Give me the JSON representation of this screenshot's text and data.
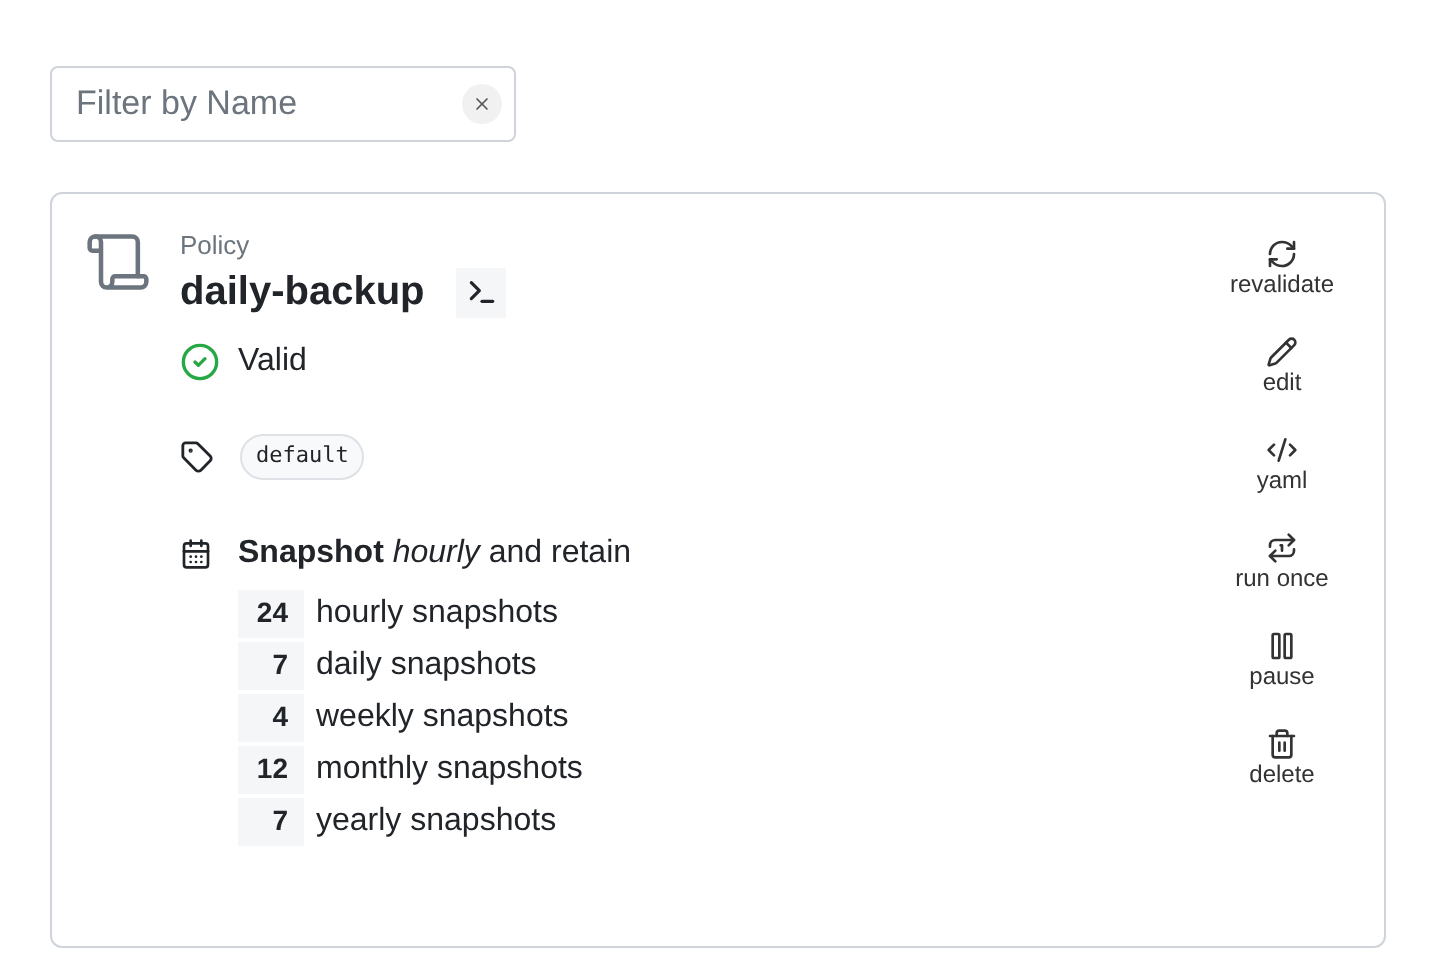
{
  "filter": {
    "placeholder": "Filter by Name"
  },
  "policy": {
    "type_label": "Policy",
    "name": "daily-backup",
    "status": {
      "kind": "valid",
      "label": "Valid"
    },
    "tags": [
      "default"
    ],
    "schedule": "**Snapshot** *hourly* and retain",
    "retention": [
      {
        "count": "24",
        "label": "hourly snapshots"
      },
      {
        "count": "7",
        "label": "daily snapshots"
      },
      {
        "count": "4",
        "label": "weekly snapshots"
      },
      {
        "count": "12",
        "label": "monthly snapshots"
      },
      {
        "count": "7",
        "label": "yearly snapshots"
      }
    ]
  },
  "actions": [
    {
      "kind": "revalidate",
      "label": "revalidate"
    },
    {
      "kind": "edit",
      "label": "edit"
    },
    {
      "kind": "yaml",
      "label": "yaml"
    },
    {
      "kind": "run",
      "label": "run once"
    },
    {
      "kind": "pause",
      "label": "pause"
    },
    {
      "kind": "delete",
      "label": "delete"
    }
  ]
}
